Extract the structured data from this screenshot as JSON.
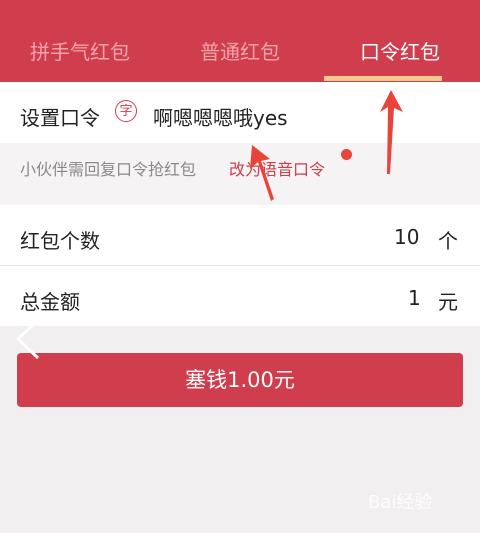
{
  "tabs": [
    {
      "label": "拼手气红包",
      "active": false
    },
    {
      "label": "普通红包",
      "active": false
    },
    {
      "label": "口令红包",
      "active": true
    }
  ],
  "password_row": {
    "label": "设置口令",
    "char_icon": "字",
    "value": "啊嗯嗯嗯哦yes"
  },
  "hint": {
    "text": "小伙伴需回复口令抢红包",
    "link": "改为语音口令"
  },
  "count_row": {
    "label": "红包个数",
    "value": "10",
    "unit": "个"
  },
  "amount_row": {
    "label": "总金额",
    "value": "1",
    "unit": "元"
  },
  "submit_button": {
    "label": "塞钱1.00元"
  },
  "watermark": {
    "text": "Bai经验"
  },
  "colors": {
    "brand_red": "#d03d4d",
    "tab_inactive": "#f0a4ad",
    "indicator": "#f7c98d",
    "annotation_red": "#e8443a"
  },
  "icons": {
    "back": "chevron-left-icon",
    "char": "char-icon",
    "annotation": "arrow-up-icon"
  }
}
